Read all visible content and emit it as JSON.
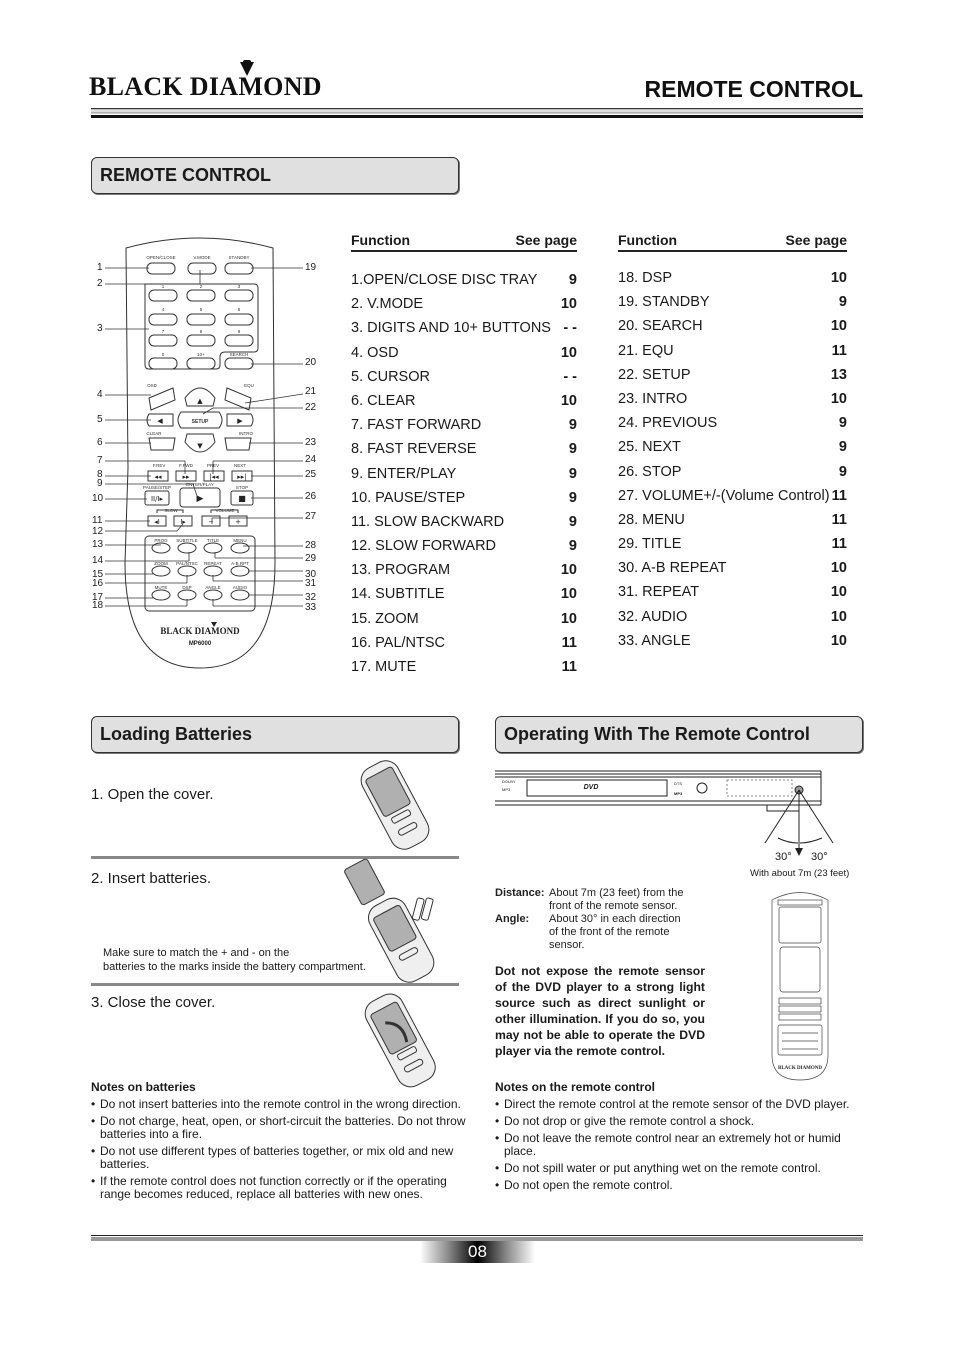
{
  "header": {
    "brand": "BLACK DIAMOND",
    "page_title": "REMOTE CONTROL"
  },
  "remote_section": {
    "title": "REMOTE CONTROL",
    "remote": {
      "brand": "BLACK DIAMOND",
      "model": "MP6000",
      "button_labels": {
        "open_close": "OPEN/CLOSE",
        "vmode": "V.MODE",
        "standby": "STANDBY",
        "d1": "1",
        "d2": "2",
        "d3": "3",
        "d4": "4",
        "d5": "5",
        "d6": "6",
        "d7": "7",
        "d8": "8",
        "d9": "9",
        "d0": "0",
        "d10": "10+",
        "search": "SEARCH",
        "osd": "OSD",
        "equ": "EQU",
        "setup": "SETUP",
        "clear": "CLEAR",
        "intro": "INTRO",
        "frev": "F.REV",
        "ffwd": "F.FWD",
        "prev": "PREV",
        "next": "NEXT",
        "pause_step": "PAUSE/STEP",
        "enter_play": "ENTER/PLAY",
        "stop": "STOP",
        "slow": "SLOW",
        "volume": "VOLUME",
        "prog": "PROG",
        "subtitle": "SUBTITLE",
        "title": "TITLE",
        "menu": "MENU",
        "zoom": "ZOOM",
        "pal_ntsc": "PAL/NTSC",
        "repeat": "REPEAT",
        "ab_rpt": "A-B RPT",
        "mute": "MUTE",
        "dsp": "DSP",
        "angle": "ANGLE",
        "audio": "AUDIO"
      },
      "callouts_left": [
        "1",
        "2",
        "3",
        "4",
        "5",
        "6",
        "7",
        "8",
        "9",
        "10",
        "11",
        "12",
        "13",
        "14",
        "15",
        "16",
        "17",
        "18"
      ],
      "callouts_right": [
        "19",
        "20",
        "21",
        "22",
        "23",
        "24",
        "25",
        "26",
        "27",
        "28",
        "29",
        "30",
        "31",
        "32",
        "33"
      ]
    },
    "table_header": {
      "function": "Function",
      "see_page": "See page"
    },
    "functions_left": [
      {
        "label": "1.OPEN/CLOSE DISC TRAY",
        "page": "9"
      },
      {
        "label": "2. V.MODE",
        "page": "10"
      },
      {
        "label": "3. DIGITS AND 10+ BUTTONS",
        "page": "- -"
      },
      {
        "label": "4. OSD",
        "page": "10"
      },
      {
        "label": "5. CURSOR",
        "page": "- -"
      },
      {
        "label": "6. CLEAR",
        "page": "10"
      },
      {
        "label": "7. FAST FORWARD",
        "page": "9"
      },
      {
        "label": "8. FAST REVERSE",
        "page": "9"
      },
      {
        "label": "9. ENTER/PLAY",
        "page": "9"
      },
      {
        "label": "10. PAUSE/STEP",
        "page": "9"
      },
      {
        "label": "11. SLOW BACKWARD",
        "page": "9"
      },
      {
        "label": "12. SLOW FORWARD",
        "page": "9"
      },
      {
        "label": "13. PROGRAM",
        "page": "10"
      },
      {
        "label": "14. SUBTITLE",
        "page": "10"
      },
      {
        "label": "15. ZOOM",
        "page": "10"
      },
      {
        "label": "16. PAL/NTSC",
        "page": "11"
      },
      {
        "label": "17. MUTE",
        "page": "11"
      }
    ],
    "functions_right": [
      {
        "label": "18. DSP",
        "page": "10"
      },
      {
        "label": "19. STANDBY",
        "page": "9"
      },
      {
        "label": "20. SEARCH",
        "page": "10"
      },
      {
        "label": "21. EQU",
        "page": "11"
      },
      {
        "label": "22. SETUP",
        "page": "13"
      },
      {
        "label": "23. INTRO",
        "page": "10"
      },
      {
        "label": "24. PREVIOUS",
        "page": "9"
      },
      {
        "label": "25. NEXT",
        "page": "9"
      },
      {
        "label": "26. STOP",
        "page": "9"
      },
      {
        "label": "27. VOLUME+/-(Volume Control)",
        "page": "11"
      },
      {
        "label": "28. MENU",
        "page": "11"
      },
      {
        "label": "29. TITLE",
        "page": "11"
      },
      {
        "label": "30. A-B REPEAT",
        "page": "10"
      },
      {
        "label": "31. REPEAT",
        "page": "10"
      },
      {
        "label": "32. AUDIO",
        "page": "10"
      },
      {
        "label": "33. ANGLE",
        "page": "10"
      }
    ]
  },
  "batteries_section": {
    "title": "Loading Batteries",
    "step1": "1. Open the cover.",
    "step2": "2. Insert batteries.",
    "step2_note_line1": "Make sure to match the + and - on the",
    "step2_note_line2": "batteries to the marks inside the battery compartment.",
    "step3": "3. Close the cover.",
    "notes_title": "Notes on batteries",
    "notes": [
      "Do not insert batteries into the remote control in the wrong direction.",
      "Do not  charge,  heat,  open,  or short-circuit  the batteries.  Do not throw batteries into a fire.",
      "Do not use different types of batteries together, or mix old and new batteries.",
      "If  the remote control does not  function correctly or if the operating range becomes reduced,  replace all batteries with new ones."
    ]
  },
  "operating_section": {
    "title": "Operating With The Remote Control",
    "angle_left": "30°",
    "angle_right": "30°",
    "range_caption": "With about 7m (23 feet)",
    "distance_label": "Distance:",
    "distance_line1": "About 7m (23 feet) from the",
    "distance_line2": "front of the remote sensor.",
    "angle_label": "Angle:",
    "angle_line1": "About 30° in each direction",
    "angle_line2": "of  the  front  of  the  remote",
    "angle_line3": "sensor.",
    "warning": "Dot  not  expose the remote sensor of  the DVD player  to a strong light source  such  as  direct  sunlight or other illumination. If you do so, you may not be able to operate the DVD player via the remote control.",
    "player_logo": "DVD",
    "small_remote_brand": "BLACK DIAMOND",
    "notes_title": "Notes on the remote control",
    "notes": [
      "Direct the remote control at the remote sensor of the DVD player.",
      "Do not drop or give the remote control a shock.",
      "Do not leave the remote control near an extremely hot or humid place.",
      "Do not spill water or put anything wet on the remote control.",
      "Do not open the remote control."
    ]
  },
  "footer": {
    "page_number": "08"
  }
}
